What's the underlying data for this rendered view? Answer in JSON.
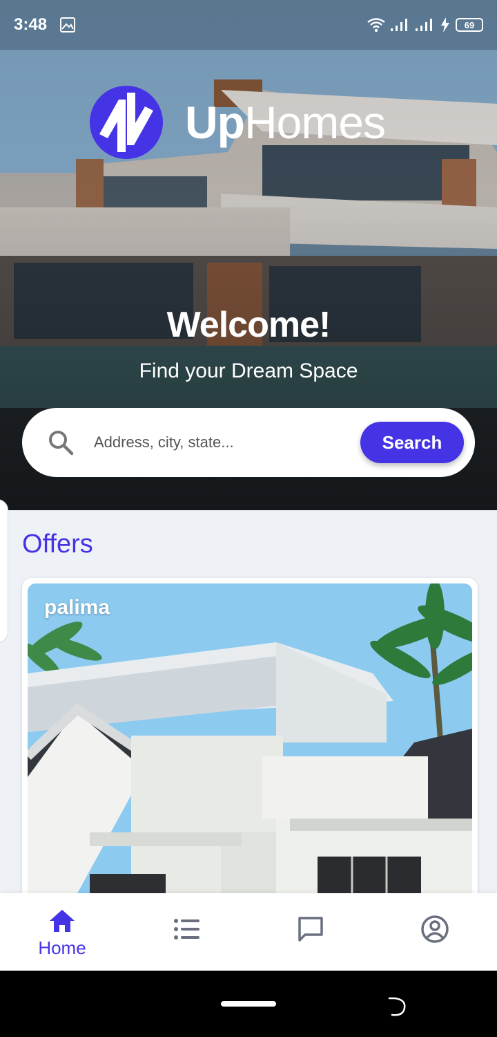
{
  "status_bar": {
    "time": "3:48",
    "battery": "69",
    "icons": [
      "image-icon",
      "wifi-icon",
      "signal-icon",
      "signal-icon",
      "charging-icon",
      "battery-icon"
    ]
  },
  "brand": {
    "name_bold": "Up",
    "name_light": "Homes",
    "accent": "#4533e6"
  },
  "hero": {
    "welcome": "Welcome!",
    "tagline": "Find your Dream Space"
  },
  "search": {
    "placeholder": "Address, city, state...",
    "button_label": "Search"
  },
  "offers": {
    "title": "Offers",
    "items": [
      {
        "name": "palima"
      }
    ]
  },
  "bottom_nav": {
    "items": [
      {
        "label": "Home",
        "icon": "home-icon",
        "active": true
      },
      {
        "label": "",
        "icon": "list-icon",
        "active": false
      },
      {
        "label": "",
        "icon": "chat-icon",
        "active": false
      },
      {
        "label": "",
        "icon": "account-icon",
        "active": false
      }
    ]
  }
}
